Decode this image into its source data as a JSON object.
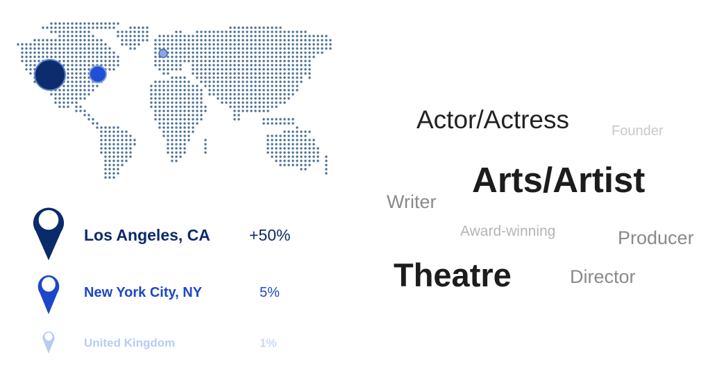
{
  "colors": {
    "map_dot": "#4f7194",
    "la": "#0b2a6b",
    "ny": "#1d47c9",
    "uk": "#b8ccf2",
    "la_bubble": "#0c2c6e",
    "ny_bubble": "#1f4fd4",
    "uk_bubble": "#8aa6e0"
  },
  "locations": [
    {
      "name": "Los Angeles, CA",
      "percent": "+50%",
      "color": "#0b2a6b"
    },
    {
      "name": "New York City, NY",
      "percent": "5%",
      "color": "#1d47c9"
    },
    {
      "name": "United Kingdom",
      "percent": "1%",
      "color": "#b8ccf2"
    }
  ],
  "word_cloud": [
    {
      "text": "Actor/Actress",
      "color": "#222222"
    },
    {
      "text": "Founder",
      "color": "#c8c8c8"
    },
    {
      "text": "Arts/Artist",
      "color": "#1c1c1c"
    },
    {
      "text": "Writer",
      "color": "#8a8a8a"
    },
    {
      "text": "Award-winning",
      "color": "#b4b4b4"
    },
    {
      "text": "Producer",
      "color": "#8a8a8a"
    },
    {
      "text": "Theatre",
      "color": "#1c1c1c"
    },
    {
      "text": "Director",
      "color": "#8a8a8a"
    }
  ]
}
